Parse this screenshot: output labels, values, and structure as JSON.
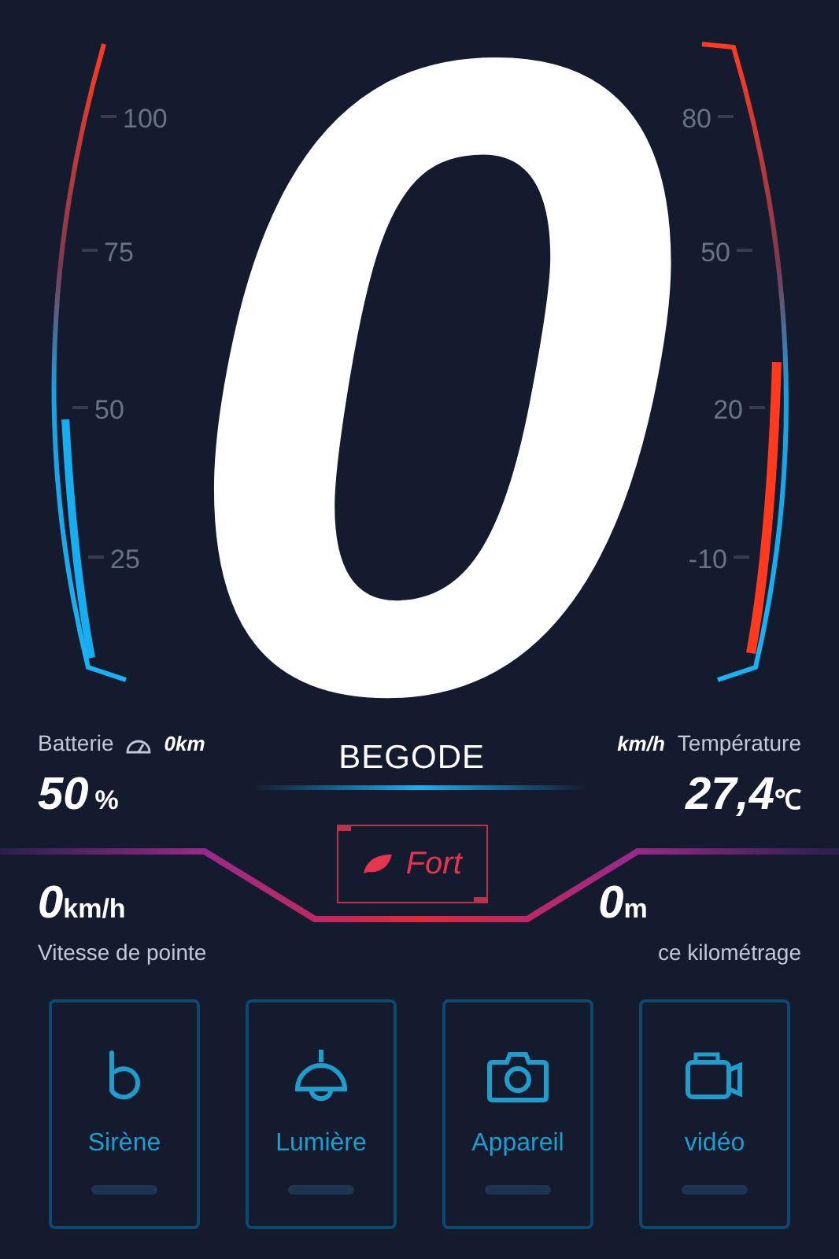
{
  "gauges": {
    "battery": {
      "ticks": [
        "100",
        "75",
        "50",
        "25"
      ]
    },
    "temperature": {
      "ticks": [
        "80",
        "50",
        "20",
        "-10"
      ]
    }
  },
  "speed": "0",
  "battery_info": {
    "label": "Batterie",
    "trip": "0km",
    "value": "50",
    "unit": "%"
  },
  "brand": "BEGODE",
  "temperature_info": {
    "speed_unit": "km/h",
    "label": "Température",
    "value": "27,4",
    "unit": "℃"
  },
  "mode_button": {
    "label": "Fort"
  },
  "top_speed": {
    "value": "0",
    "unit": "km/h",
    "label": "Vitesse de pointe"
  },
  "distance": {
    "value": "0",
    "unit": "m",
    "label": "ce kilométrage"
  },
  "controls": [
    {
      "kind": "siren",
      "label": "Sirène",
      "on": false
    },
    {
      "kind": "light",
      "label": "Lumière",
      "on": false
    },
    {
      "kind": "camera",
      "label": "Appareil",
      "on": false
    },
    {
      "kind": "video",
      "label": "vidéo",
      "on": false
    }
  ]
}
